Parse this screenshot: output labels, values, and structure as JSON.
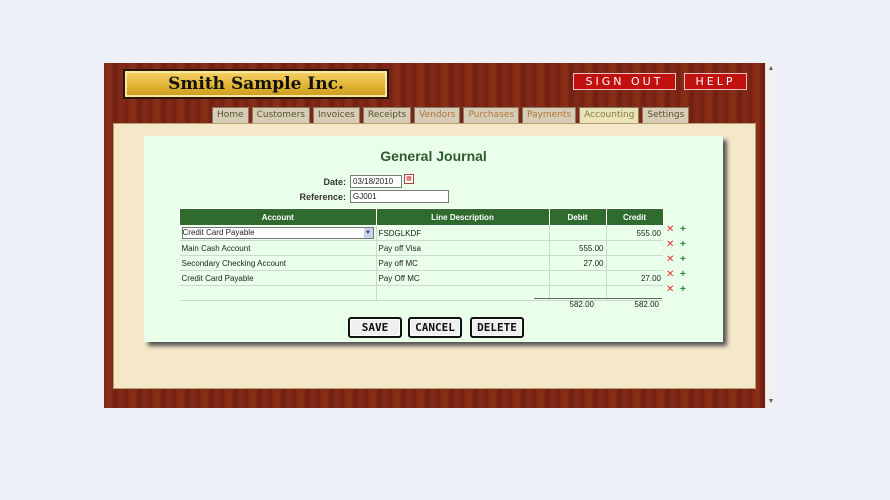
{
  "app": {
    "company_name": "Smith Sample Inc."
  },
  "header": {
    "sign_out_label": "SIGN OUT",
    "help_label": "HELP"
  },
  "tabs": [
    {
      "label": "Home"
    },
    {
      "label": "Customers"
    },
    {
      "label": "Invoices"
    },
    {
      "label": "Receipts"
    },
    {
      "label": "Vendors"
    },
    {
      "label": "Purchases"
    },
    {
      "label": "Payments"
    },
    {
      "label": "Accounting"
    },
    {
      "label": "Settings"
    }
  ],
  "form": {
    "title": "General Journal",
    "date_label": "Date:",
    "date_value": "03/18/2010",
    "reference_label": "Reference:",
    "reference_value": "GJ001"
  },
  "table": {
    "headers": [
      "Account",
      "Line Description",
      "Debit",
      "Credit"
    ],
    "rows": [
      {
        "account": "Credit Card Payable",
        "description": "FSDGLKDF",
        "debit": "",
        "credit": "555.00"
      },
      {
        "account": "Main Cash Account",
        "description": "Pay off Visa",
        "debit": "555.00",
        "credit": ""
      },
      {
        "account": "Secondary Checking Account",
        "description": "Pay off MC",
        "debit": "27.00",
        "credit": ""
      },
      {
        "account": "Credit Card Payable",
        "description": "Pay Off MC",
        "debit": "",
        "credit": "27.00"
      },
      {
        "account": "",
        "description": "",
        "debit": "",
        "credit": ""
      }
    ],
    "total_debit": "582.00",
    "total_credit": "582.00"
  },
  "buttons": {
    "save": "SAVE",
    "cancel": "CANCEL",
    "delete": "DELETE"
  },
  "icons": {
    "remove": "close-icon",
    "add": "plus-icon",
    "calendar": "calendar-icon"
  },
  "colors": {
    "header_green": "#2f6a2f",
    "title_green": "#2f5a2f",
    "sign_out_red": "#c01010"
  }
}
